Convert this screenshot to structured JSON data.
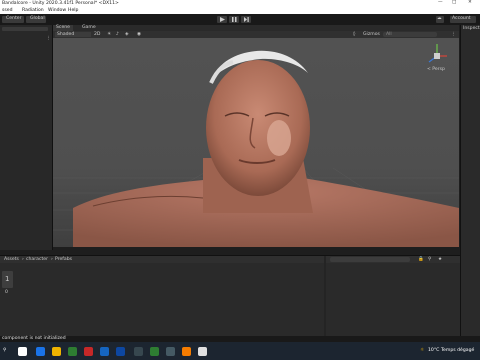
{
  "window": {
    "title": "Bandalcore - Unity 2020.3.41f1 Personal* <DX11>"
  },
  "menu": [
    "ssed",
    "Radiation",
    "Window",
    "Help"
  ],
  "toolbar": {
    "center_label": "Center",
    "global_label": "Global"
  },
  "scene_tabs": [
    "Scene",
    "Game"
  ],
  "scene_options": {
    "shading_mode": "Shaded",
    "mode_2d": "2D",
    "gizmos_label": "Gizmos",
    "search_placeholder": "All",
    "gizmo_view_label": "< Persp"
  },
  "inspector": {
    "tab_label": "Inspect",
    "account_label": "Account"
  },
  "project": {
    "breadcrumb": [
      "Assets",
      "character",
      "Prefabs"
    ],
    "item_count": "1",
    "item_name": "0"
  },
  "status": {
    "message": "component is not initialized"
  },
  "taskbar": {
    "weather": "10°C",
    "weather_desc": "Temps dégagé"
  },
  "colors": {
    "accent": "#3a79d8",
    "viewport": "#4d4d4d"
  }
}
